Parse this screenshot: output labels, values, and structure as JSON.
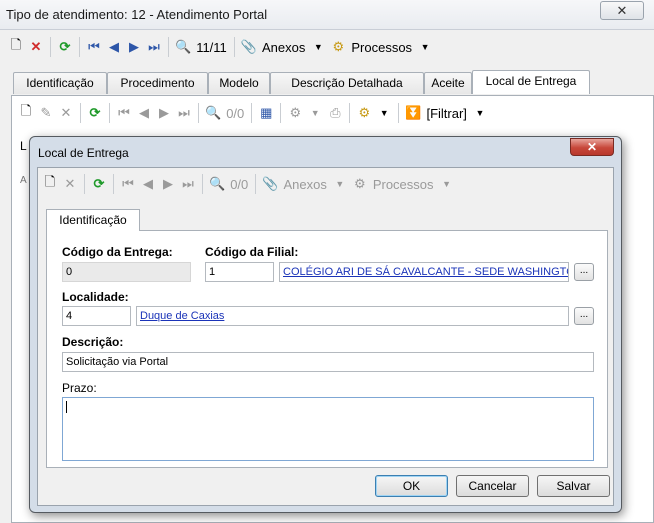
{
  "window": {
    "title": "Tipo de atendimento: 12 - Atendimento Portal",
    "close_glyph": "✕"
  },
  "main_toolbar": {
    "record_counter": "11/11",
    "anexos_label": "Anexos",
    "processos_label": "Processos"
  },
  "tabs": [
    {
      "label": "Identificação"
    },
    {
      "label": "Procedimento"
    },
    {
      "label": "Modelo"
    },
    {
      "label": "Descrição Detalhada"
    },
    {
      "label": "Aceite"
    },
    {
      "label": "Local de Entrega"
    }
  ],
  "sub_toolbar": {
    "record_counter": "0/0",
    "filter_label": "[Filtrar]"
  },
  "dialog": {
    "title": "Local de Entrega",
    "close_glyph": "✕",
    "toolbar": {
      "record_counter": "0/0",
      "anexos_label": "Anexos",
      "processos_label": "Processos"
    },
    "tab_label": "Identificação",
    "form": {
      "codigo_entrega_label": "Código da Entrega:",
      "codigo_entrega_value": "0",
      "codigo_filial_label": "Código da Filial:",
      "codigo_filial_value": "1",
      "filial_name": "COLÉGIO ARI DE SÁ CAVALCANTE - SEDE WASHINGTON SOARES",
      "localidade_label": "Localidade:",
      "localidade_value": "4",
      "localidade_name": "Duque de Caxias",
      "descricao_label": "Descrição:",
      "descricao_value": "Solicitação via Portal",
      "prazo_label": "Prazo:",
      "prazo_value": "",
      "lookup_glyph": "..."
    },
    "buttons": {
      "ok": "OK",
      "cancel": "Cancelar",
      "save": "Salvar"
    }
  },
  "background_fragments": {
    "l1": "L",
    "l2": "A"
  }
}
